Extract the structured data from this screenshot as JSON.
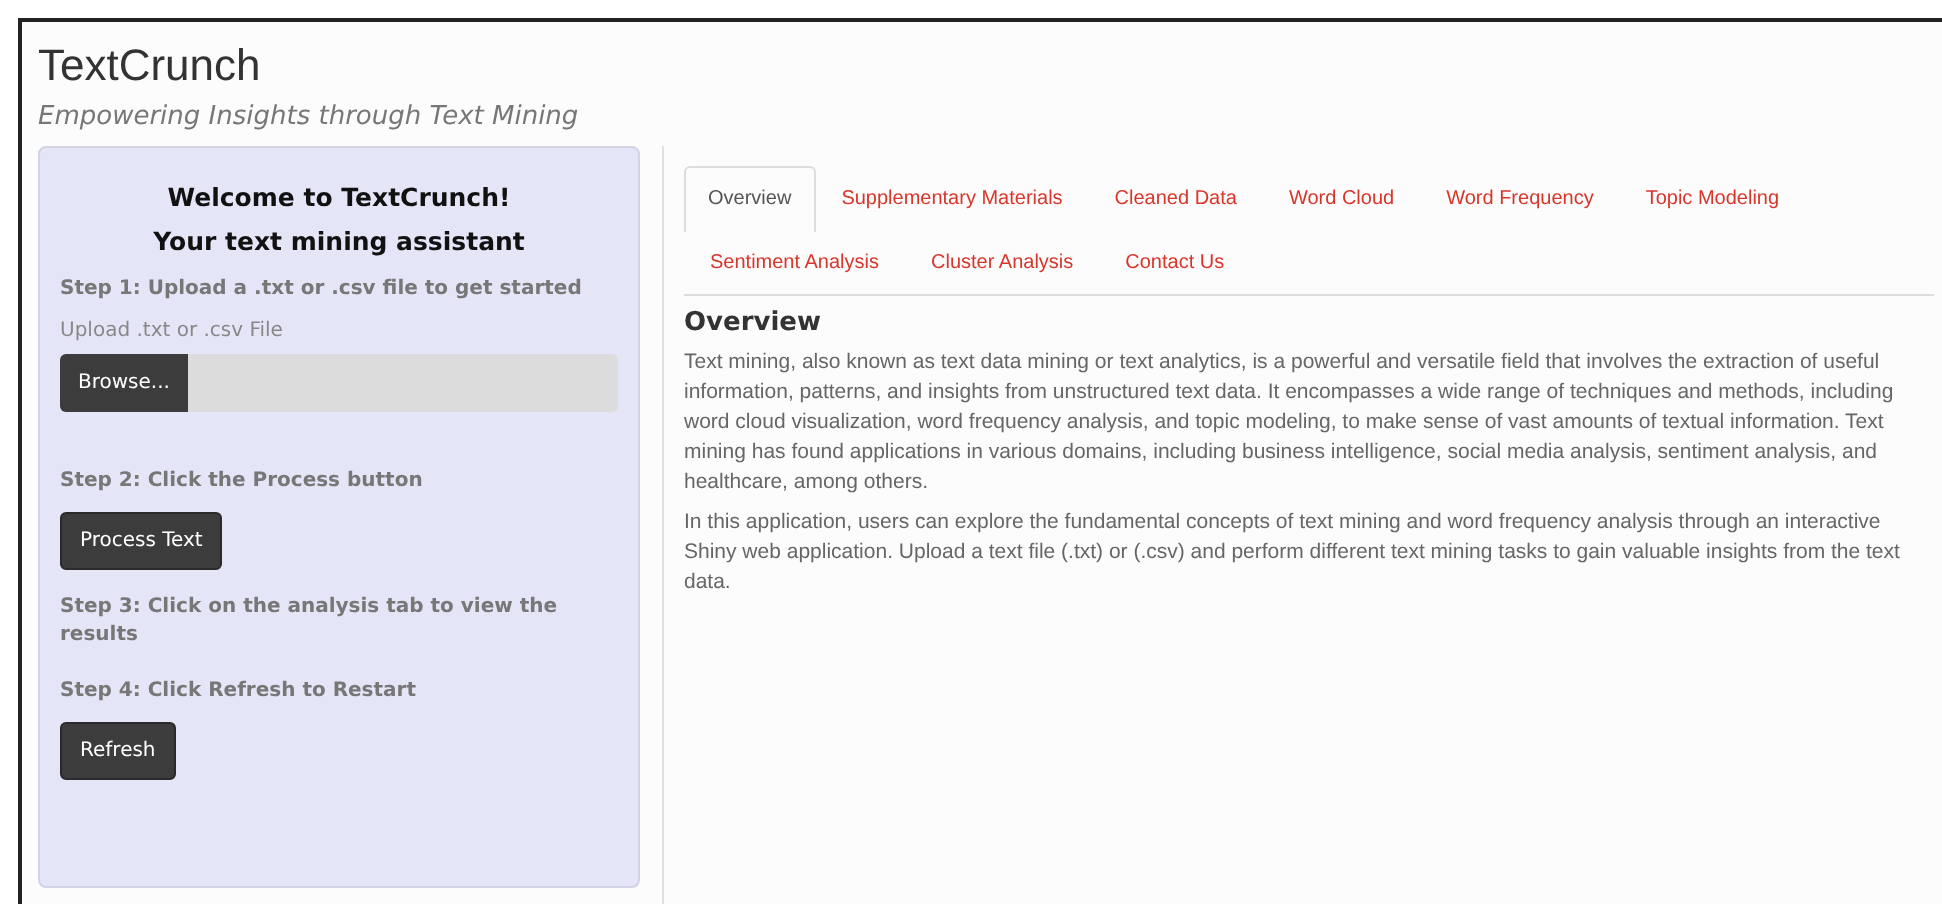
{
  "app": {
    "title": "TextCrunch",
    "subtitle": "Empowering Insights through Text Mining"
  },
  "sidebar": {
    "heading": [
      "Welcome to TextCrunch!",
      "Your text mining assistant"
    ],
    "steps": [
      {
        "kind": "upload",
        "label": "Step 1: Upload a .txt or .csv file to get started",
        "field_label": "Upload .txt or .csv File",
        "button": "Browse..."
      },
      {
        "kind": "button",
        "label": "Step 2: Click the Process button",
        "button": "Process Text"
      },
      {
        "kind": "text",
        "label": "Step 3: Click on the analysis tab to view the results"
      },
      {
        "kind": "button",
        "label": "Step 4: Click Refresh to Restart",
        "button": "Refresh"
      }
    ]
  },
  "tabs": [
    {
      "label": "Overview",
      "selected": true
    },
    {
      "label": "Supplementary Materials",
      "selected": false
    },
    {
      "label": "Cleaned Data",
      "selected": false
    },
    {
      "label": "Word Cloud",
      "selected": false
    },
    {
      "label": "Word Frequency",
      "selected": false
    },
    {
      "label": "Topic Modeling",
      "selected": false
    },
    {
      "label": "Sentiment Analysis",
      "selected": false
    },
    {
      "label": "Cluster Analysis",
      "selected": false
    },
    {
      "label": "Contact Us",
      "selected": false
    }
  ],
  "content": {
    "heading": "Overview",
    "paragraphs": [
      "Text mining, also known as text data mining or text analytics, is a powerful and versatile field that involves the extraction of useful information, patterns, and insights from unstructured text data. It encompasses a wide range of techniques and methods, including word cloud visualization, word frequency analysis, and topic modeling, to make sense of vast amounts of textual information. Text mining has found applications in various domains, including business intelligence, social media analysis, sentiment analysis, and healthcare, among others.",
      "In this application, users can explore the fundamental concepts of text mining and word frequency analysis through an interactive Shiny web application. Upload a text file (.txt) or (.csv) and perform different text mining tasks to gain valuable insights from the text data."
    ]
  }
}
